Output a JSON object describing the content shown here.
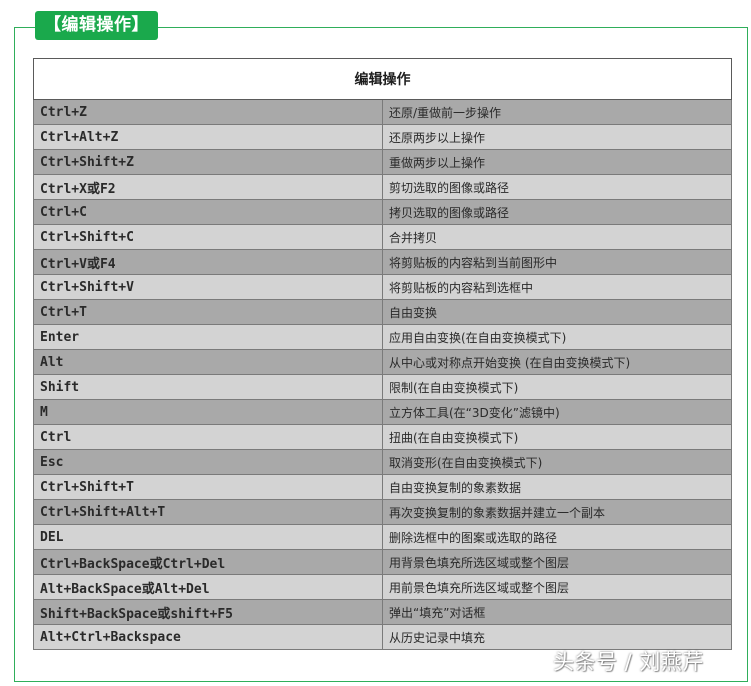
{
  "section_title": "【编辑操作】",
  "table": {
    "header": "编辑操作",
    "rows": [
      {
        "key": "Ctrl+Z",
        "desc": "还原/重做前一步操作"
      },
      {
        "key": "Ctrl+Alt+Z",
        "desc": "还原两步以上操作"
      },
      {
        "key": "Ctrl+Shift+Z",
        "desc": "重做两步以上操作"
      },
      {
        "key": "Ctrl+X或F2",
        "desc": "剪切选取的图像或路径"
      },
      {
        "key": "Ctrl+C",
        "desc": "拷贝选取的图像或路径"
      },
      {
        "key": "Ctrl+Shift+C",
        "desc": "合并拷贝"
      },
      {
        "key": "Ctrl+V或F4",
        "desc": "将剪贴板的内容粘到当前图形中"
      },
      {
        "key": "Ctrl+Shift+V",
        "desc": "将剪贴板的内容粘到选框中"
      },
      {
        "key": "Ctrl+T",
        "desc": "自由变换"
      },
      {
        "key": "Enter",
        "desc": "应用自由变换(在自由变换模式下)"
      },
      {
        "key": "Alt",
        "desc": "从中心或对称点开始变换 (在自由变换模式下)"
      },
      {
        "key": "Shift",
        "desc": "限制(在自由变换模式下)"
      },
      {
        "key": "M",
        "desc": "立方体工具(在“3D变化”滤镜中)"
      },
      {
        "key": "Ctrl",
        "desc": "扭曲(在自由变换模式下)"
      },
      {
        "key": "Esc",
        "desc": "取消变形(在自由变换模式下)"
      },
      {
        "key": "Ctrl+Shift+T",
        "desc": "自由变换复制的象素数据"
      },
      {
        "key": "Ctrl+Shift+Alt+T",
        "desc": "再次变换复制的象素数据并建立一个副本"
      },
      {
        "key": "DEL",
        "desc": "删除选框中的图案或选取的路径"
      },
      {
        "key": "Ctrl+BackSpace或Ctrl+Del",
        "desc": "用背景色填充所选区域或整个图层"
      },
      {
        "key": "Alt+BackSpace或Alt+Del",
        "desc": "用前景色填充所选区域或整个图层"
      },
      {
        "key": "Shift+BackSpace或shift+F5",
        "desc": "弹出“填充”对话框"
      },
      {
        "key": "Alt+Ctrl+Backspace",
        "desc": "从历史记录中填充"
      }
    ]
  },
  "watermark": "头条号 / 刘燕芹",
  "colors": {
    "accent_green": "#1aa94c",
    "row_dark": "#a9a9a9",
    "row_light": "#d3d3d3"
  }
}
